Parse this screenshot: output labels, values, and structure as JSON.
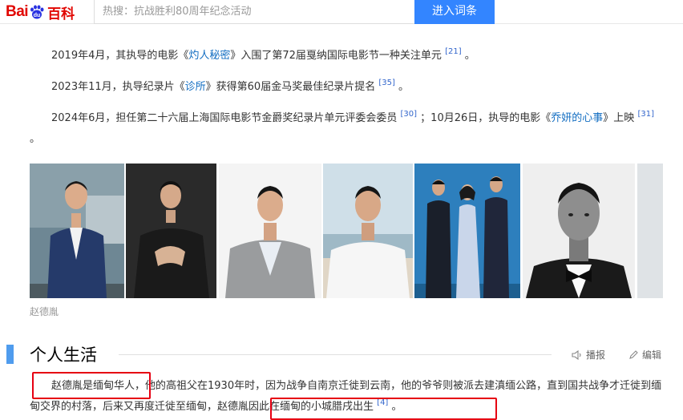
{
  "header": {
    "logo": {
      "part1": "Bai",
      "part2": "du",
      "part3": "百科"
    },
    "search_placeholder": "热搜：抗战胜利80周年纪念活动",
    "search_button": "进入词条"
  },
  "paragraphs": [
    {
      "pre": "2019年4月，其执导的电影《",
      "link": "灼人秘密",
      "post": "》入围了第72届戛纳国际电影节一种关注单元",
      "ref": "[21]",
      "end": "。"
    },
    {
      "pre": "2023年11月，执导纪录片《",
      "link": "诊所",
      "post": "》获得第60届金马奖最佳纪录片提名",
      "ref": "[35]",
      "end": "。"
    },
    {
      "pre": "2024年6月，担任第二十六届上海国际电影节金爵奖纪录片单元评委会委员",
      "ref1": "[30]",
      "mid": "；10月26日，执导的电影《",
      "link": "乔妍的心事",
      "post": "》上映",
      "ref": "[31]",
      "end": "。"
    }
  ],
  "gallery": {
    "caption": "赵德胤",
    "photo_count": 7
  },
  "section": {
    "title": "个人生活",
    "play_label": "播报",
    "edit_label": "编辑"
  },
  "life_paragraph": {
    "part1": "赵德胤是缅甸华人，",
    "part2": "他的高祖父在1930年时，因为战争自南京迁徙到云南，他的爷爷则被派去建滇缅公路，直到国共战争才迁徙到缅甸交界的村落，后来又再度迁徙至缅甸，",
    "part3": "赵德胤因此在缅甸的小城腊戌出生",
    "ref": "[4]",
    "end": "。"
  },
  "colors": {
    "brand_red": "#e10601",
    "search_blue": "#3385ff",
    "link_blue": "#136ec2",
    "section_bar": "#4f9cee",
    "highlight_box": "#e60012"
  }
}
